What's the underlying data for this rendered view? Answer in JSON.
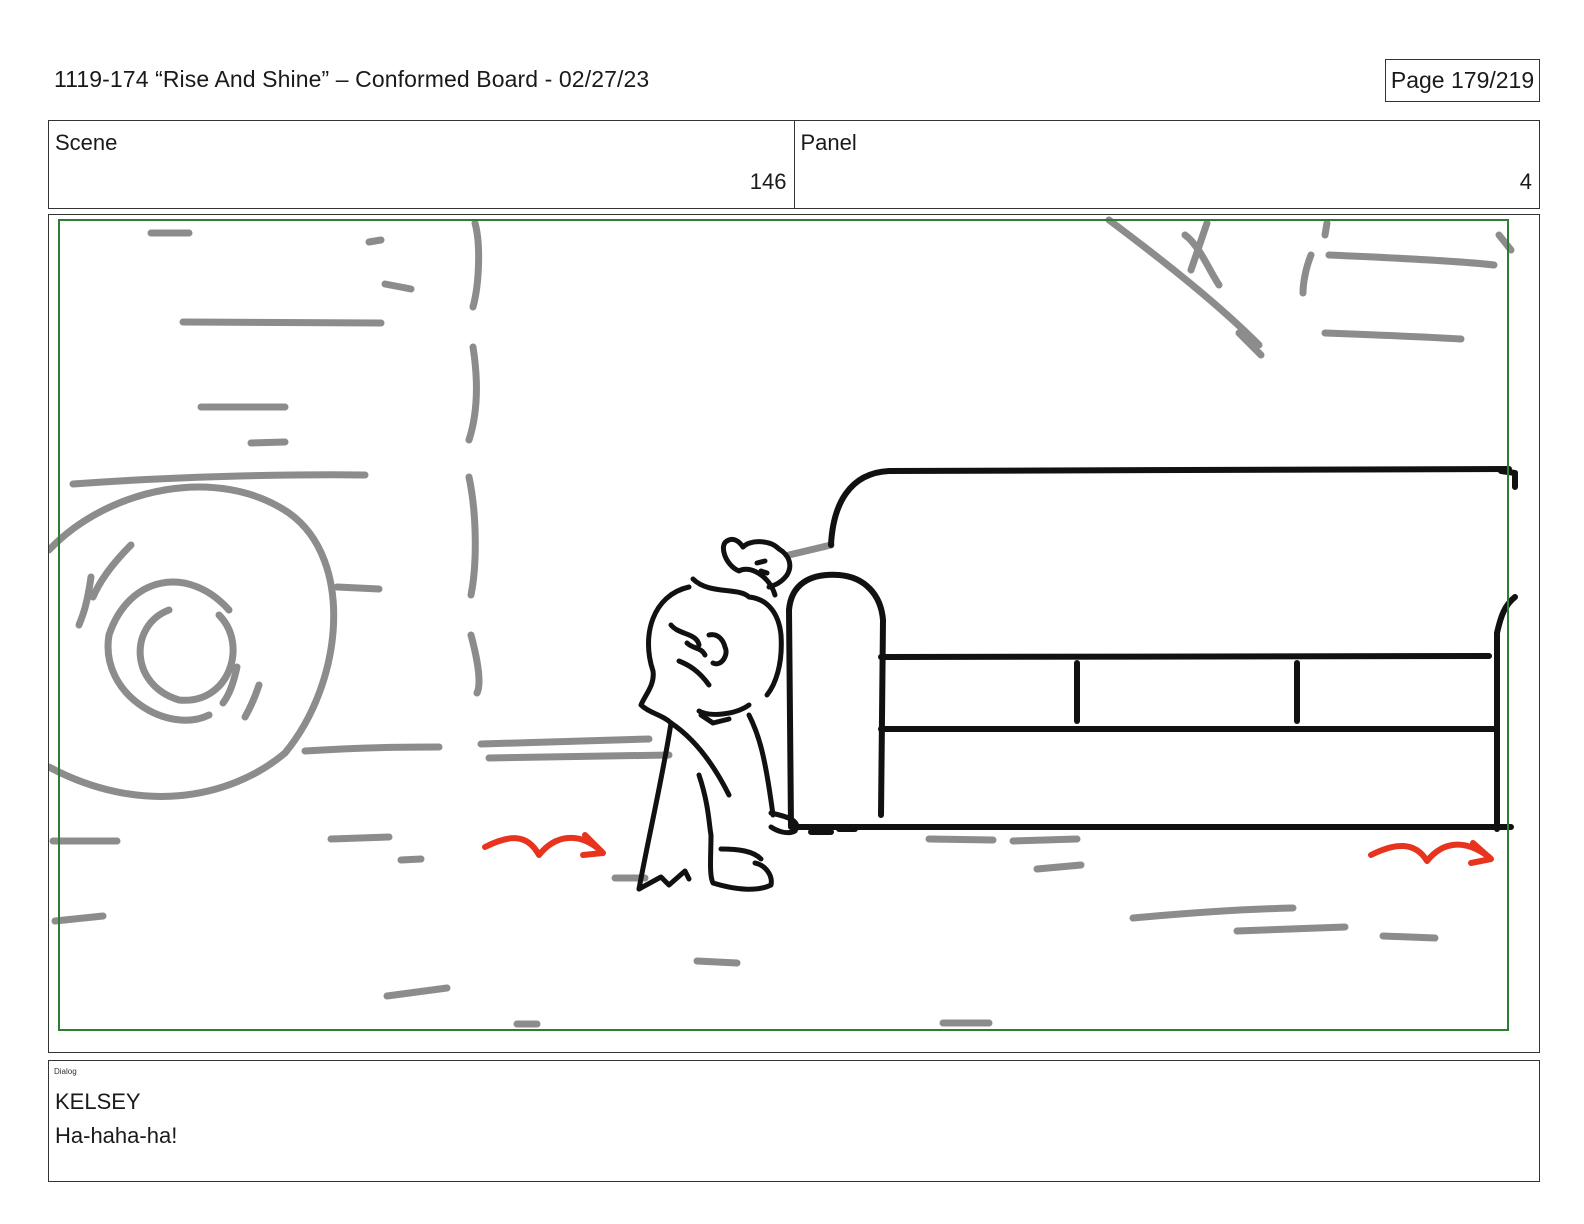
{
  "header": {
    "title": "1119-174 “Rise And Shine” – Conformed Board - 02/27/23",
    "page": "Page 179/219"
  },
  "info": {
    "scene_label": "Scene",
    "scene_value": "146",
    "panel_label": "Panel",
    "panel_value": "4"
  },
  "panel": {
    "safe_area_color": "#2e7d32",
    "motion_arrow_color": "#e8331f",
    "line_color": "#111111",
    "background_line_color": "#8c8c8c"
  },
  "dialog": {
    "label": "Dialog",
    "character": "KELSEY",
    "line": "Ha-haha-ha!"
  }
}
